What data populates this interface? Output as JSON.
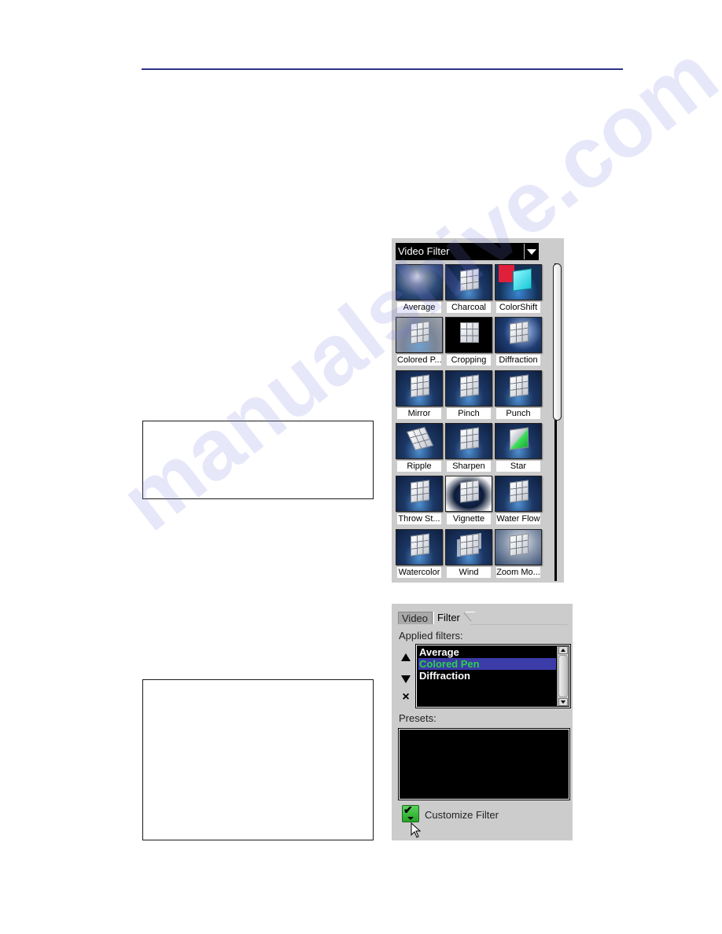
{
  "filter_library": {
    "category_dropdown": {
      "selected": "Video Filter"
    },
    "filters": [
      {
        "label": "Average",
        "key": "average"
      },
      {
        "label": "Charcoal",
        "key": "charcoal"
      },
      {
        "label": "ColorShift",
        "key": "colorshift"
      },
      {
        "label": "Colored P...",
        "key": "coloredpen"
      },
      {
        "label": "Cropping",
        "key": "cropping"
      },
      {
        "label": "Diffraction",
        "key": "diffraction"
      },
      {
        "label": "Mirror",
        "key": "mirror"
      },
      {
        "label": "Pinch",
        "key": "pinch"
      },
      {
        "label": "Punch",
        "key": "punch"
      },
      {
        "label": "Ripple",
        "key": "ripple"
      },
      {
        "label": "Sharpen",
        "key": "sharpen"
      },
      {
        "label": "Star",
        "key": "star"
      },
      {
        "label": "Throw St...",
        "key": "throwstone"
      },
      {
        "label": "Vignette",
        "key": "vignette"
      },
      {
        "label": "Water Flow",
        "key": "waterflow"
      },
      {
        "label": "Watercolor",
        "key": "watercolor"
      },
      {
        "label": "Wind",
        "key": "wind"
      },
      {
        "label": "Zoom Mo...",
        "key": "zoommotion"
      }
    ]
  },
  "options_panel": {
    "tabs": [
      {
        "label": "Video",
        "active": false
      },
      {
        "label": "Filter",
        "active": true
      }
    ],
    "applied_filters_label": "Applied filters:",
    "applied_filters": [
      {
        "label": "Average",
        "selected": false
      },
      {
        "label": "Colored Pen",
        "selected": true
      },
      {
        "label": "Diffraction",
        "selected": false
      }
    ],
    "move_up_icon": "triangle-up",
    "move_down_icon": "triangle-down",
    "remove_icon": "×",
    "presets_label": "Presets:",
    "customize_label": "Customize Filter",
    "customize_icon": "✔"
  },
  "colors": {
    "header_rule": "#2e3388",
    "panel_bg": "#cccccc",
    "selected_row_bg": "#3c3ca8",
    "selected_row_text": "#2ad24a",
    "customize_green": "#3cbc3c"
  },
  "watermark": "manualshive.com"
}
